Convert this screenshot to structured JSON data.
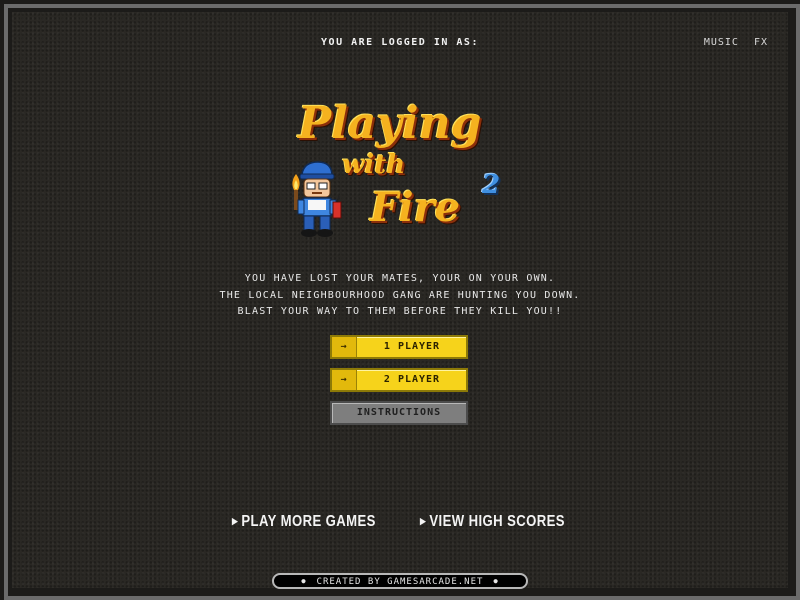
{
  "header": {
    "logged_in_label": "YOU ARE LOGGED IN AS:",
    "toggle_music": "MUSIC",
    "toggle_fx": "FX"
  },
  "logo": {
    "word1": "Playing",
    "word2": "with",
    "word3": "Fire",
    "number": "2"
  },
  "description": {
    "line1": "YOU HAVE LOST YOUR MATES, YOUR ON YOUR OWN.",
    "line2": "THE LOCAL NEIGHBOURHOOD GANG ARE HUNTING YOU DOWN.",
    "line3": "BLAST YOUR WAY TO THEM BEFORE THEY KILL YOU!!"
  },
  "menu": {
    "one_player": "1 PLAYER",
    "two_player": "2 PLAYER",
    "instructions": "INSTRUCTIONS",
    "arrow": "→"
  },
  "links": {
    "play_more": "PLAY MORE GAMES",
    "high_scores": "VIEW HIGH SCORES",
    "bullet": "▶"
  },
  "footer": {
    "text": "CREATED BY GAMESARCADE.NET",
    "dot": "●"
  },
  "colors": {
    "background": "#2a2824",
    "button_yellow": "#f6d31b",
    "button_gray": "#7e7e7e",
    "logo_orange": "#f5b21f",
    "logo_blue": "#3f8fe0"
  }
}
